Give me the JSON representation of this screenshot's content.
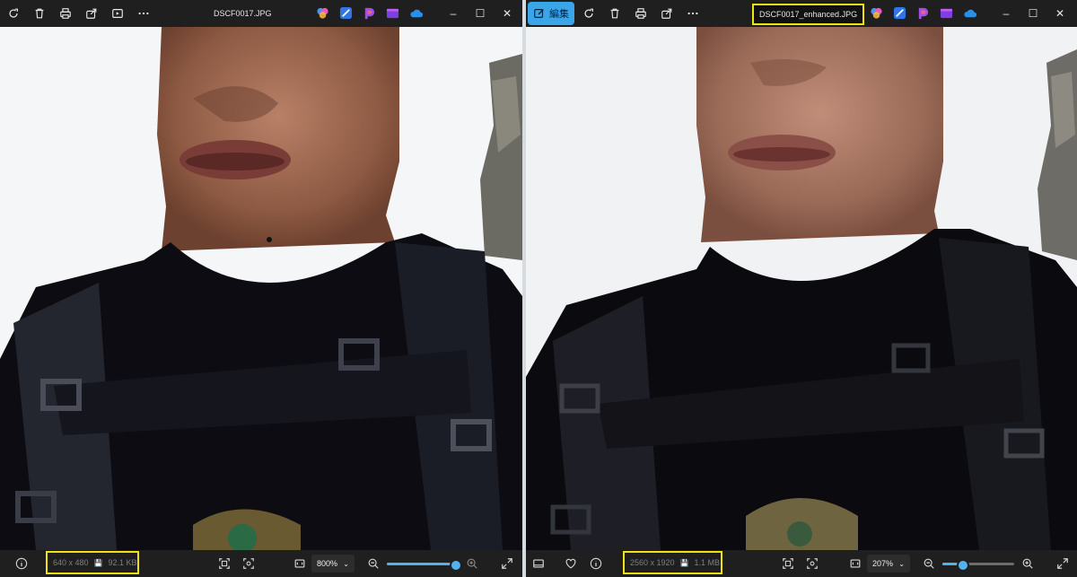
{
  "left_window": {
    "title": "DSCF0017.JPG",
    "dimensions": "640 x 480",
    "file_size": "92.1 KB",
    "zoom": "800%",
    "zoom_slider_fraction": 0.96
  },
  "right_window": {
    "edit_label": "編集",
    "title": "DSCF0017_enhanced.JPG",
    "dimensions": "2560 x 1920",
    "file_size": "1.1 MB",
    "zoom": "207%",
    "zoom_slider_fraction": 0.29
  },
  "icons": {
    "rotate": "rotate-icon",
    "delete": "delete-icon",
    "print": "print-icon",
    "share": "share-icon",
    "slideshow": "slideshow-icon",
    "more": "more-icon",
    "info": "info-icon",
    "favorite": "heart-icon",
    "zoom_out": "zoom-out-icon",
    "zoom_in": "zoom-in-icon",
    "fullscreen": "fullscreen-icon"
  },
  "colors": {
    "highlight": "#f1e214",
    "accent": "#53b1f0",
    "titlebar": "#1f1f1f"
  }
}
